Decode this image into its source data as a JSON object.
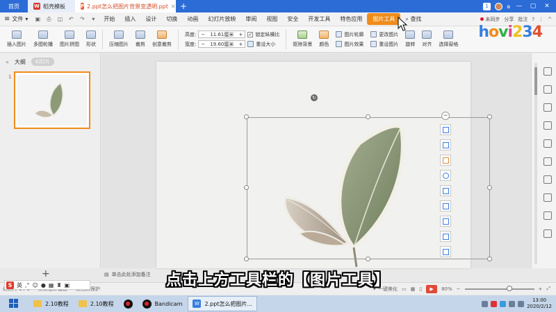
{
  "titlebar": {
    "home_tab": "首页",
    "wps_tab": "稻壳模板",
    "doc_tab": "2.ppt怎么把图片背景变透明.ppt",
    "add_tab": "+",
    "badge": "1",
    "user": "a"
  },
  "menubar": {
    "file": "文件",
    "items": [
      "开始",
      "插入",
      "设计",
      "切换",
      "动画",
      "幻灯片放映",
      "审阅",
      "视图",
      "安全",
      "开发工具",
      "特色应用",
      "图片工具",
      "查找"
    ],
    "active_item": "图片工具",
    "right": {
      "unsynced": "未同步",
      "share": "分享",
      "comment": "批注"
    }
  },
  "ribbon": {
    "buttons_left": [
      "插入图片",
      "多图轮播",
      "图片拼图",
      "形状"
    ],
    "buttons_mid": [
      "压缩图片",
      "裁剪",
      "创意裁剪"
    ],
    "height_label": "高度:",
    "height_value": "11.61厘米",
    "width_label": "宽度:",
    "width_value": "19.60厘米",
    "lock_ratio": "锁定纵横比",
    "reset_size": "重设大小",
    "buttons_right": [
      "抠除背景",
      "颜色"
    ],
    "stack": {
      "outline": "图片轮廓",
      "effect": "图片效果",
      "change": "更改图片",
      "reset": "重设图片"
    },
    "far_right": [
      "旋转",
      "对齐",
      "选择窗格"
    ]
  },
  "watermark": {
    "letters": [
      "h",
      "o",
      "v",
      "i",
      "2",
      "3",
      "4"
    ]
  },
  "leftpanel": {
    "tab_outline": "大纲",
    "tab_slides": "幻灯片",
    "slide_number": "1",
    "add": "+"
  },
  "notes": {
    "placeholder": "单击此处添加备注"
  },
  "caption": {
    "text": "点击上方工具栏的【图片工具】"
  },
  "statusbar": {
    "slide_info": "幻灯片 1 / 1",
    "theme": "默认设计模板",
    "protect": "文档未保护",
    "beautify": "一键美化",
    "zoom": "80%",
    "ime_lang": "英"
  },
  "taskbar": {
    "tasks": [
      "2.10教程",
      "2.10教程",
      "",
      "Bandicam",
      "2.ppt怎么把图片..."
    ],
    "date": "2020/2/12",
    "time": "13:00"
  }
}
